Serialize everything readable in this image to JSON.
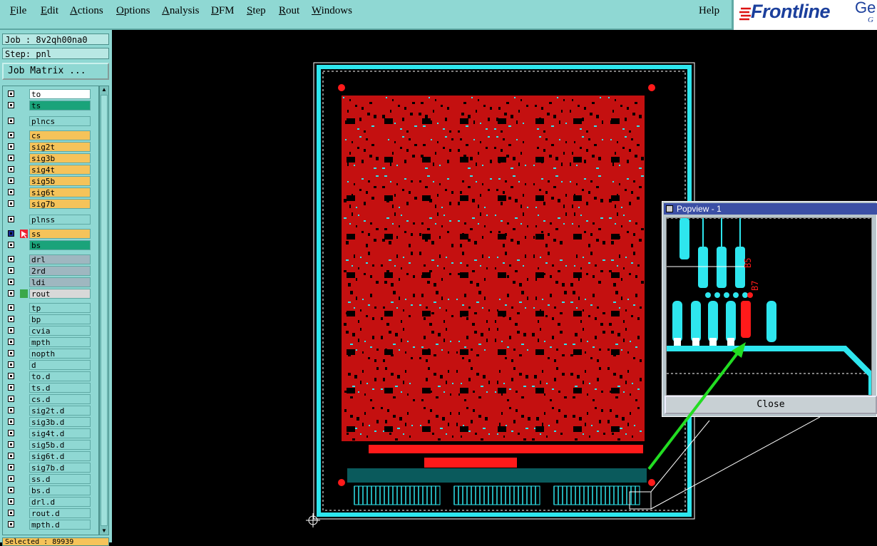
{
  "menubar": {
    "items": [
      {
        "label": "File",
        "u": "F",
        "rest": "ile"
      },
      {
        "label": "Edit",
        "u": "E",
        "rest": "dit"
      },
      {
        "label": "Actions",
        "u": "A",
        "rest": "ctions"
      },
      {
        "label": "Options",
        "u": "O",
        "rest": "ptions"
      },
      {
        "label": "Analysis",
        "u": "A",
        "rest": "nalysis"
      },
      {
        "label": "DFM",
        "u": "D",
        "rest": "FM"
      },
      {
        "label": "Step",
        "u": "S",
        "rest": "tep"
      },
      {
        "label": "Rout",
        "u": "R",
        "rest": "out"
      },
      {
        "label": "Windows",
        "u": "W",
        "rest": "indows"
      }
    ],
    "help": "Help",
    "logo": "Frontline",
    "logo_partial": "Ge",
    "logo_sub": "G"
  },
  "job": "Job : 8v2qh00na0",
  "step": "Step: pnl",
  "job_matrix_button": "Job Matrix ...",
  "layers": [
    {
      "name": "to",
      "color": "#ffffff",
      "flag": ""
    },
    {
      "name": "ts",
      "color": "#1aa37a",
      "flag": ""
    },
    {
      "name": "plncs",
      "color": "#8fd8d3",
      "flag": ""
    },
    {
      "name": "cs",
      "color": "#f5c35a",
      "flag": ""
    },
    {
      "name": "sig2t",
      "color": "#f5c35a",
      "flag": ""
    },
    {
      "name": "sig3b",
      "color": "#f5c35a",
      "flag": ""
    },
    {
      "name": "sig4t",
      "color": "#f5c35a",
      "flag": ""
    },
    {
      "name": "sig5b",
      "color": "#f5c35a",
      "flag": ""
    },
    {
      "name": "sig6t",
      "color": "#f5c35a",
      "flag": ""
    },
    {
      "name": "sig7b",
      "color": "#f5c35a",
      "flag": ""
    },
    {
      "name": "plnss",
      "color": "#8fd8d3",
      "flag": ""
    },
    {
      "name": "ss",
      "color": "#f5c35a",
      "flag": "active"
    },
    {
      "name": "bs",
      "color": "#1aa37a",
      "flag": ""
    },
    {
      "name": "drl",
      "color": "#9fb7c0",
      "flag": ""
    },
    {
      "name": "2rd",
      "color": "#9fb7c0",
      "flag": ""
    },
    {
      "name": "ldi",
      "color": "#9fb7c0",
      "flag": ""
    },
    {
      "name": "rout",
      "color": "#d8d8d8",
      "flag": "green"
    },
    {
      "name": "tp",
      "color": "#8fd8d3",
      "flag": ""
    },
    {
      "name": "bp",
      "color": "#8fd8d3",
      "flag": ""
    },
    {
      "name": "cvia",
      "color": "#8fd8d3",
      "flag": ""
    },
    {
      "name": "mpth",
      "color": "#8fd8d3",
      "flag": ""
    },
    {
      "name": "nopth",
      "color": "#8fd8d3",
      "flag": ""
    },
    {
      "name": "d",
      "color": "#8fd8d3",
      "flag": ""
    },
    {
      "name": "to.d",
      "color": "#8fd8d3",
      "flag": ""
    },
    {
      "name": "ts.d",
      "color": "#8fd8d3",
      "flag": ""
    },
    {
      "name": "cs.d",
      "color": "#8fd8d3",
      "flag": ""
    },
    {
      "name": "sig2t.d",
      "color": "#8fd8d3",
      "flag": ""
    },
    {
      "name": "sig3b.d",
      "color": "#8fd8d3",
      "flag": ""
    },
    {
      "name": "sig4t.d",
      "color": "#8fd8d3",
      "flag": ""
    },
    {
      "name": "sig5b.d",
      "color": "#8fd8d3",
      "flag": ""
    },
    {
      "name": "sig6t.d",
      "color": "#8fd8d3",
      "flag": ""
    },
    {
      "name": "sig7b.d",
      "color": "#8fd8d3",
      "flag": ""
    },
    {
      "name": "ss.d",
      "color": "#8fd8d3",
      "flag": ""
    },
    {
      "name": "bs.d",
      "color": "#8fd8d3",
      "flag": ""
    },
    {
      "name": "drl.d",
      "color": "#8fd8d3",
      "flag": ""
    },
    {
      "name": "rout.d",
      "color": "#8fd8d3",
      "flag": ""
    },
    {
      "name": "mpth.d",
      "color": "#8fd8d3",
      "flag": ""
    }
  ],
  "selected": "Selected : 89939",
  "popview": {
    "title": "Popview - 1",
    "close": "Close",
    "labels": [
      "B5",
      "B7"
    ]
  },
  "colors": {
    "cyan": "#2ee6ee",
    "red": "#ff1a1a",
    "arrow": "#22dd22"
  }
}
